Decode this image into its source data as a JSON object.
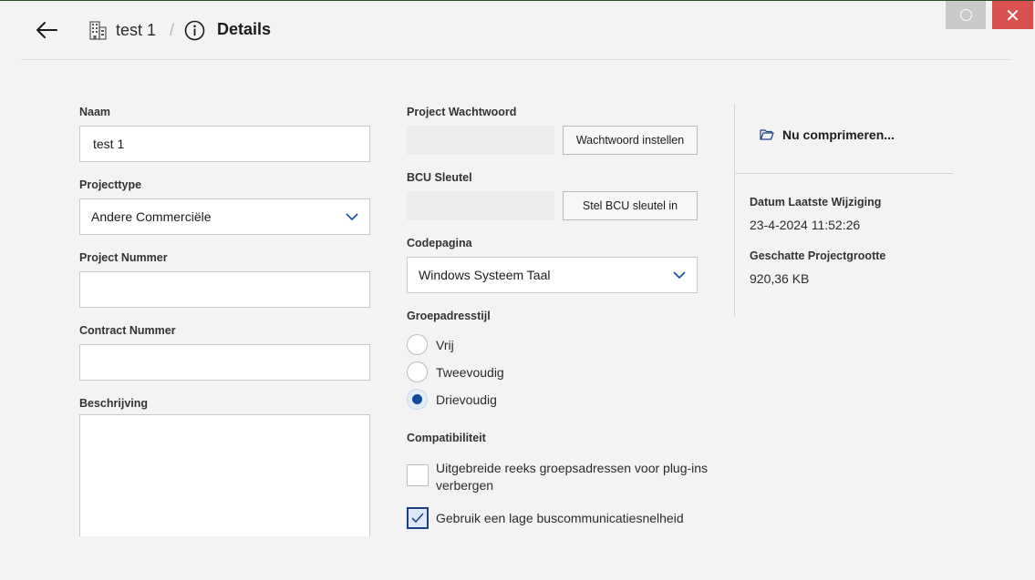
{
  "window": {
    "close_glyph": "✕",
    "restore_icon": "circle-icon"
  },
  "header": {
    "back_icon": "arrow-left-icon",
    "project_icon": "building-icon",
    "project_name": "test 1",
    "separator": "/",
    "info_icon": "info-circle-icon",
    "page_title": "Details"
  },
  "form": {
    "naam": {
      "label": "Naam",
      "value": "test 1"
    },
    "projecttype": {
      "label": "Projecttype",
      "value": "Andere Commerciële"
    },
    "project_nummer": {
      "label": "Project Nummer",
      "value": ""
    },
    "contract_nummer": {
      "label": "Contract Nummer",
      "value": ""
    },
    "beschrijving": {
      "label": "Beschrijving",
      "value": ""
    }
  },
  "security": {
    "password_label": "Project Wachtwoord",
    "password_button": "Wachtwoord instellen",
    "bcu_label": "BCU Sleutel",
    "bcu_button": "Stel BCU sleutel in"
  },
  "codepagina": {
    "label": "Codepagina",
    "value": "Windows Systeem Taal"
  },
  "groepadresstijl": {
    "label": "Groepadresstijl",
    "options": [
      {
        "label": "Vrij",
        "checked": false
      },
      {
        "label": "Tweevoudig",
        "checked": false
      },
      {
        "label": "Drievoudig",
        "checked": true
      }
    ]
  },
  "compatibiliteit": {
    "label": "Compatibiliteit",
    "options": [
      {
        "label": "Uitgebreide reeks groepsadressen voor plug-ins verbergen",
        "checked": false
      },
      {
        "label": "Gebruik een lage buscommunicatiesnelheid",
        "checked": true
      }
    ]
  },
  "side": {
    "compress_icon": "folder-open-icon",
    "compress_label": "Nu comprimeren...",
    "last_modified_label": "Datum Laatste Wijziging",
    "last_modified_value": "23-4-2024 11:52:26",
    "size_label": "Geschatte Projectgrootte",
    "size_value": "920,36 KB"
  },
  "colors": {
    "accent": "#114a9c",
    "close": "#d9504f"
  }
}
